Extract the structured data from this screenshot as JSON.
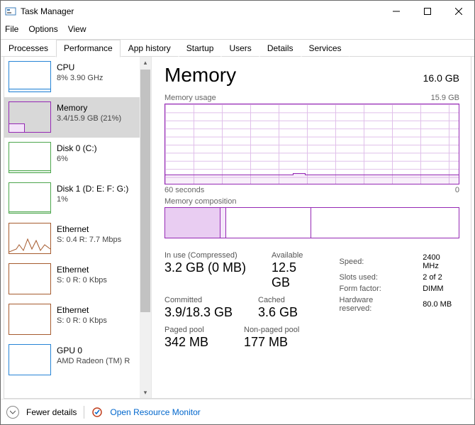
{
  "window": {
    "title": "Task Manager"
  },
  "menu": {
    "file": "File",
    "options": "Options",
    "view": "View"
  },
  "tabs": [
    "Processes",
    "Performance",
    "App history",
    "Startup",
    "Users",
    "Details",
    "Services"
  ],
  "active_tab": 1,
  "sidebar": {
    "items": [
      {
        "name": "CPU",
        "sub": "8% 3.90 GHz"
      },
      {
        "name": "Memory",
        "sub": "3.4/15.9 GB (21%)"
      },
      {
        "name": "Disk 0 (C:)",
        "sub": "6%"
      },
      {
        "name": "Disk 1 (D: E: F: G:)",
        "sub": "1%"
      },
      {
        "name": "Ethernet",
        "sub": "S: 0.4 R: 7.7 Mbps"
      },
      {
        "name": "Ethernet",
        "sub": "S: 0 R: 0 Kbps"
      },
      {
        "name": "Ethernet",
        "sub": "S: 0 R: 0 Kbps"
      },
      {
        "name": "GPU 0",
        "sub": "AMD Radeon (TM) R"
      }
    ]
  },
  "main": {
    "title": "Memory",
    "total": "16.0 GB",
    "usage_label": "Memory usage",
    "usage_right": "15.9 GB",
    "axis_left": "60 seconds",
    "axis_right": "0",
    "comp_label": "Memory composition",
    "stats": {
      "in_use_lbl": "In use (Compressed)",
      "in_use_val": "3.2 GB (0 MB)",
      "available_lbl": "Available",
      "available_val": "12.5 GB",
      "committed_lbl": "Committed",
      "committed_val": "3.9/18.3 GB",
      "cached_lbl": "Cached",
      "cached_val": "3.6 GB",
      "paged_lbl": "Paged pool",
      "paged_val": "342 MB",
      "nonpaged_lbl": "Non-paged pool",
      "nonpaged_val": "177 MB"
    },
    "info": {
      "speed_lbl": "Speed:",
      "speed_val": "2400 MHz",
      "slots_lbl": "Slots used:",
      "slots_val": "2 of 2",
      "form_lbl": "Form factor:",
      "form_val": "DIMM",
      "hw_lbl": "Hardware reserved:",
      "hw_val": "80.0 MB"
    }
  },
  "footer": {
    "fewer": "Fewer details",
    "orm": "Open Resource Monitor"
  }
}
